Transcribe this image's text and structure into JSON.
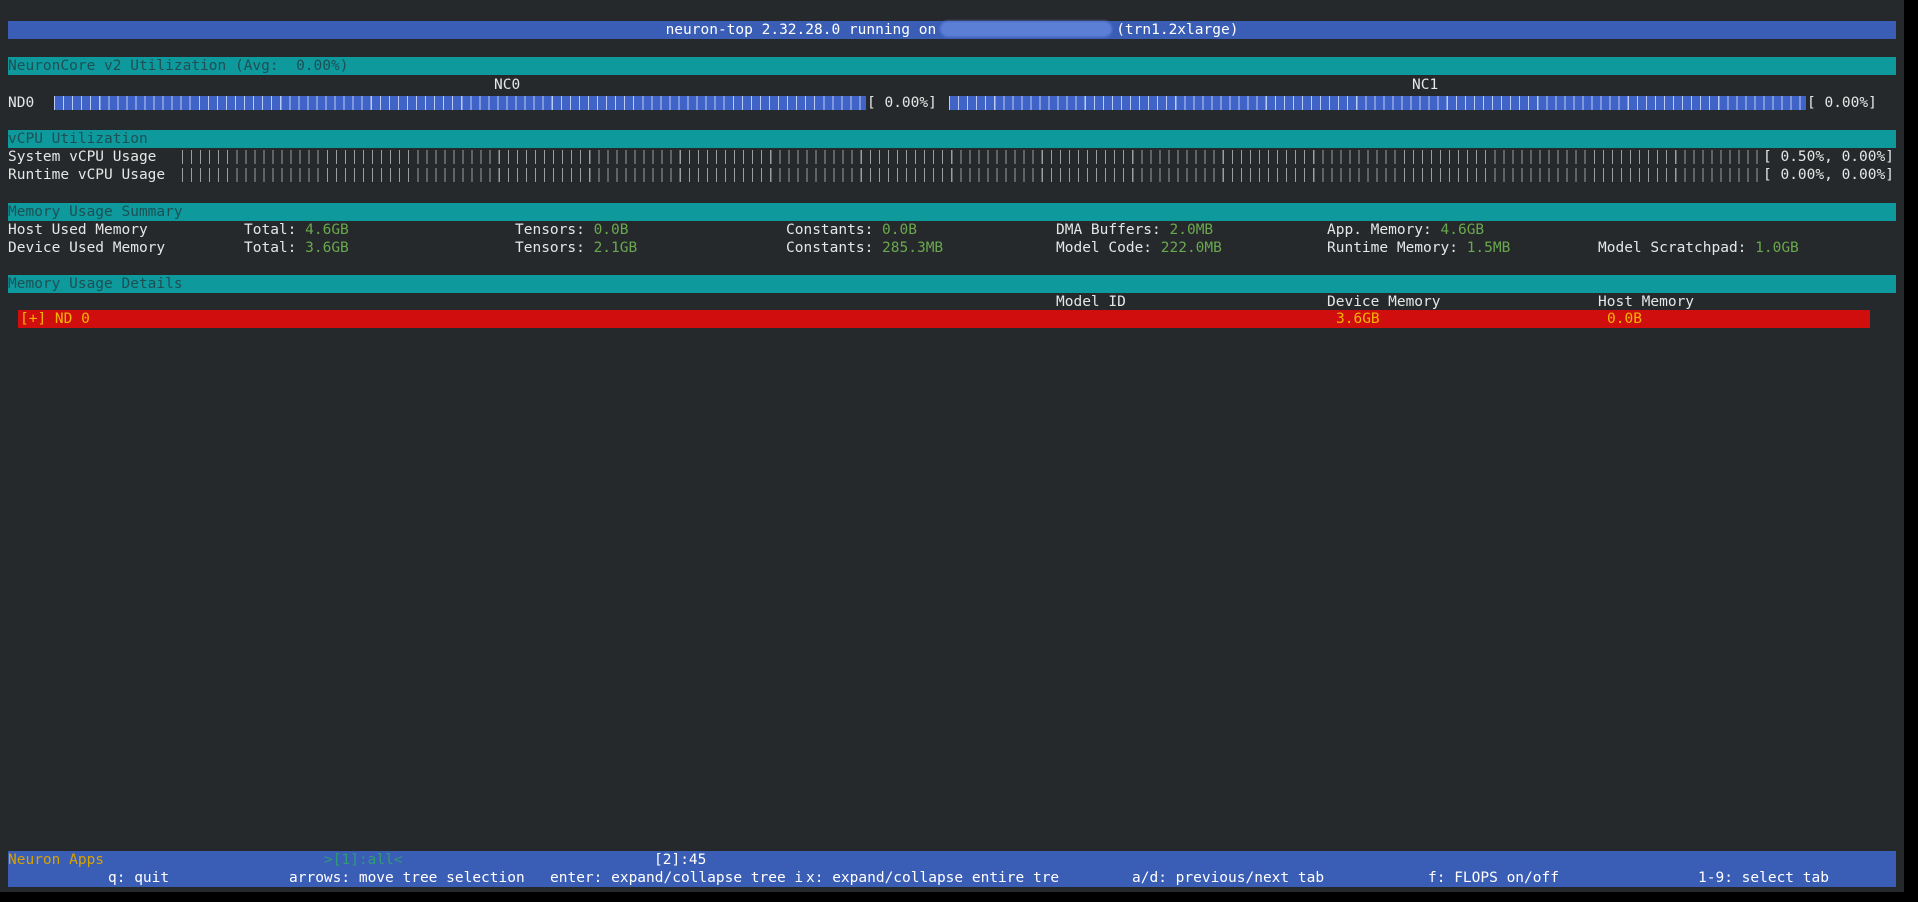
{
  "title_bar": {
    "prefix": "neuron-top 2.32.28.0 running on",
    "suffix": "(trn1.2xlarge)"
  },
  "neuroncore": {
    "section_title": "NeuronCore v2 Utilization (Avg:  0.00%)",
    "device_label": "ND0",
    "cores": [
      {
        "name": "NC0",
        "value": "[ 0.00%]",
        "utilization_percent": 0.0
      },
      {
        "name": "NC1",
        "value": "[ 0.00%]",
        "utilization_percent": 0.0
      }
    ]
  },
  "vcpu": {
    "section_title": "vCPU Utilization",
    "rows": [
      {
        "label": "System vCPU Usage",
        "value": "[ 0.50%, 0.00%]"
      },
      {
        "label": "Runtime vCPU Usage",
        "value": "[ 0.00%, 0.00%]"
      }
    ]
  },
  "memory_summary": {
    "section_title": "Memory Usage Summary",
    "host": {
      "label": "Host Used Memory",
      "total_label": "Total:",
      "total_value": "4.6GB",
      "tensors_label": "Tensors:",
      "tensors_value": "0.0B",
      "constants_label": "Constants:",
      "constants_value": "0.0B",
      "dma_label": "DMA Buffers:",
      "dma_value": "2.0MB",
      "app_label": "App. Memory:",
      "app_value": "4.6GB"
    },
    "device": {
      "label": "Device Used Memory",
      "total_label": "Total:",
      "total_value": "3.6GB",
      "tensors_label": "Tensors:",
      "tensors_value": "2.1GB",
      "constants_label": "Constants:",
      "constants_value": "285.3MB",
      "code_label": "Model Code:",
      "code_value": "222.0MB",
      "runtime_label": "Runtime Memory:",
      "runtime_value": "1.5MB",
      "scratch_label": "Model Scratchpad:",
      "scratch_value": "1.0GB"
    }
  },
  "memory_details": {
    "section_title": "Memory Usage Details",
    "columns": [
      "Model ID",
      "Device Memory",
      "Host Memory"
    ],
    "rows": [
      {
        "name": "[+] ND 0",
        "device_memory": "3.6GB",
        "host_memory": "0.0B"
      }
    ]
  },
  "footer": {
    "apps_label": "Neuron Apps",
    "selected_tab": ">[1]:all<",
    "other_tab": "[2]:45",
    "keys": [
      "q: quit",
      "arrows: move tree selection",
      "enter: expand/collapse tree i",
      "x: expand/collapse entire tre",
      "a/d: previous/next tab",
      "f: FLOPS on/off",
      "1-9: select tab"
    ]
  },
  "colors": {
    "terminal_bg": "#25292b",
    "title_bar": "#3a5db5",
    "section_bar": "#0e9a9c",
    "value_green": "#6aa84f",
    "row_red": "#d10e0e",
    "row_text_yellow": "#f3b400"
  }
}
